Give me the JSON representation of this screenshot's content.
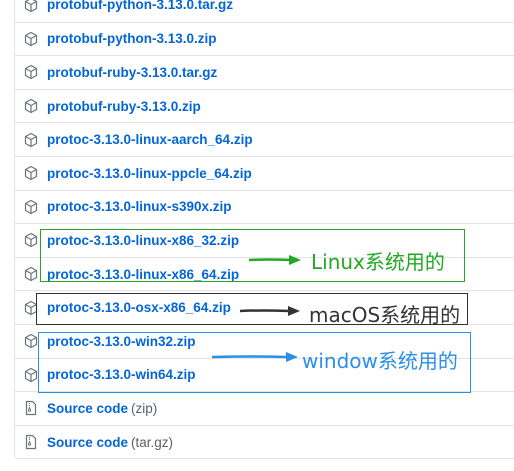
{
  "assets": [
    {
      "name": "protobuf-python-3.13.0.tar.gz",
      "icon": "package-icon"
    },
    {
      "name": "protobuf-python-3.13.0.zip",
      "icon": "package-icon"
    },
    {
      "name": "protobuf-ruby-3.13.0.tar.gz",
      "icon": "package-icon"
    },
    {
      "name": "protobuf-ruby-3.13.0.zip",
      "icon": "package-icon"
    },
    {
      "name": "protoc-3.13.0-linux-aarch_64.zip",
      "icon": "package-icon"
    },
    {
      "name": "protoc-3.13.0-linux-ppcle_64.zip",
      "icon": "package-icon"
    },
    {
      "name": "protoc-3.13.0-linux-s390x.zip",
      "icon": "package-icon"
    },
    {
      "name": "protoc-3.13.0-linux-x86_32.zip",
      "icon": "package-icon"
    },
    {
      "name": "protoc-3.13.0-linux-x86_64.zip",
      "icon": "package-icon"
    },
    {
      "name": "protoc-3.13.0-osx-x86_64.zip",
      "icon": "package-icon"
    },
    {
      "name": "protoc-3.13.0-win32.zip",
      "icon": "package-icon"
    },
    {
      "name": "protoc-3.13.0-win64.zip",
      "icon": "package-icon"
    }
  ],
  "sources": [
    {
      "label": "Source code",
      "ext": "(zip)",
      "icon": "file-zip-icon"
    },
    {
      "label": "Source code",
      "ext": "(tar.gz)",
      "icon": "file-zip-icon"
    }
  ],
  "annotations": {
    "linux": {
      "text": "Linux系统用的",
      "color": "#22a822"
    },
    "macos": {
      "text": "macOS系统用的",
      "color": "#333333"
    },
    "windows": {
      "text": "window系统用的",
      "color": "#2b8fe8"
    }
  },
  "colors": {
    "link": "#0366d6",
    "border": "#e1e4e8",
    "icon": "#6a737d"
  }
}
